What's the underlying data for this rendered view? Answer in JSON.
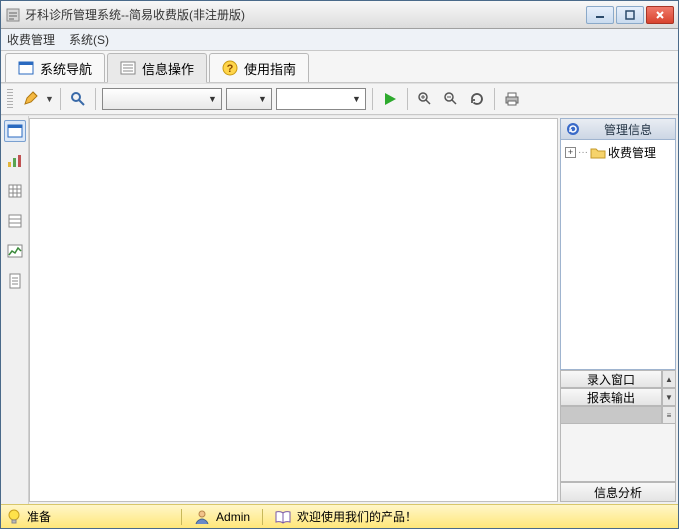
{
  "window": {
    "title": "牙科诊所管理系统--简易收费版(非注册版)"
  },
  "menu": {
    "items": [
      "收费管理",
      "系统(S)"
    ]
  },
  "tabs": {
    "items": [
      {
        "label": "系统导航"
      },
      {
        "label": "信息操作"
      },
      {
        "label": "使用指南"
      }
    ]
  },
  "toolbar": {
    "combo1": "",
    "combo2": "",
    "combo3": ""
  },
  "right": {
    "header": "管理信息",
    "tree_item": "收费管理",
    "tab1": "录入窗口",
    "tab2": "报表输出",
    "footer": "信息分析"
  },
  "status": {
    "ready": "准备",
    "user": "Admin",
    "welcome": "欢迎使用我们的产品！"
  }
}
